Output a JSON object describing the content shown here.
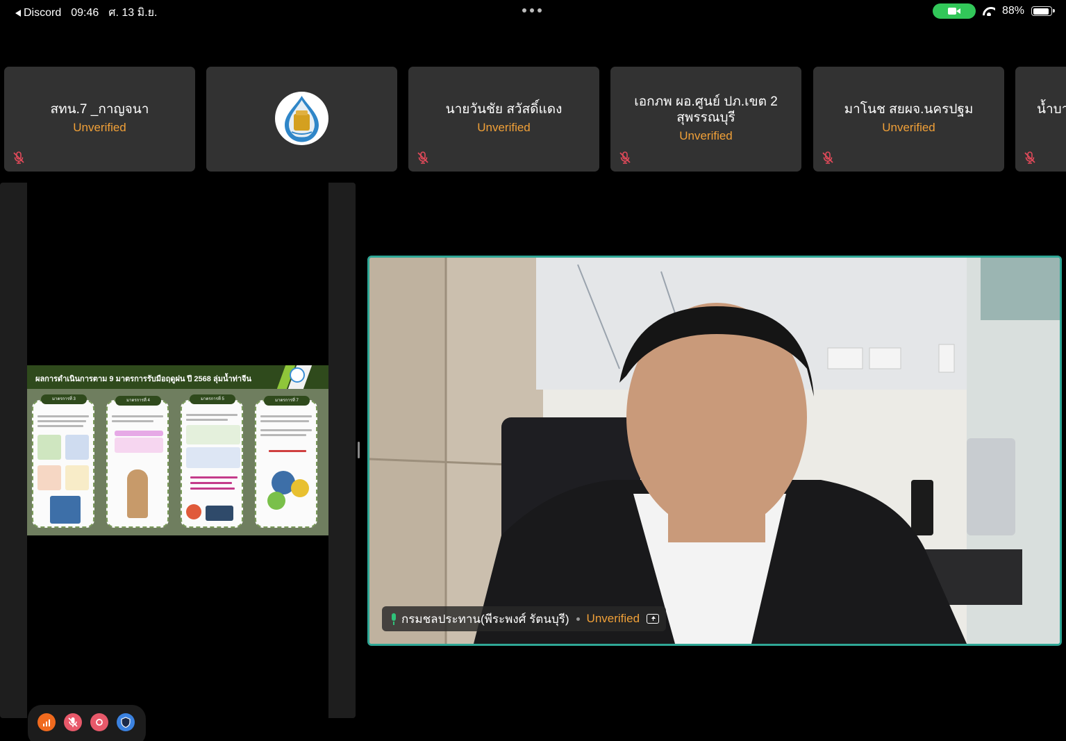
{
  "status_bar": {
    "back_app": "Discord",
    "time": "09:46",
    "date": "ศ. 13 มิ.ย.",
    "battery_level": "88%",
    "battery_fraction": 0.88
  },
  "participants": [
    {
      "name": "สทน.7 _กาญจนา",
      "status": "Unverified",
      "muted": true
    },
    {
      "name": "",
      "status": "",
      "muted": false,
      "avatar": "royal-irrigation-logo-icon"
    },
    {
      "name": "นายวันชัย สวัสดิ์แดง",
      "status": "Unverified",
      "muted": true
    },
    {
      "name": "เอกภพ ผอ.ศูนย์ ปภ.เขต 2 สุพรรณบุรี",
      "status": "Unverified",
      "muted": true
    },
    {
      "name": "มาโนช สยผจ.นครปฐม",
      "status": "Unverified",
      "muted": true
    },
    {
      "name": "น้ำบา",
      "status": "",
      "muted": true
    }
  ],
  "screen_share": {
    "slide_title": "ผลการดำเนินการตาม 9 มาตรการรับมือฤดูฝน ปี 2568 ลุ่มน้ำท่าจีน",
    "cards": [
      {
        "tag": "มาตรการที่ 3"
      },
      {
        "tag": "มาตรการที่ 4"
      },
      {
        "tag": "มาตรการที่ 5"
      },
      {
        "tag": "มาตรการที่ 7"
      }
    ]
  },
  "main_video": {
    "speaker_name": "กรมชลประทาน(พีระพงศ์ รัตนบุรี)",
    "status": "Unverified"
  },
  "toolbar": {
    "buttons": [
      "signal-icon",
      "mute-icon",
      "record-icon",
      "shield-icon"
    ]
  },
  "colors": {
    "tile_bg": "#323232",
    "unverified": "#f0a038",
    "speaking_border": "#2fa796",
    "camera_on": "#32c759"
  }
}
